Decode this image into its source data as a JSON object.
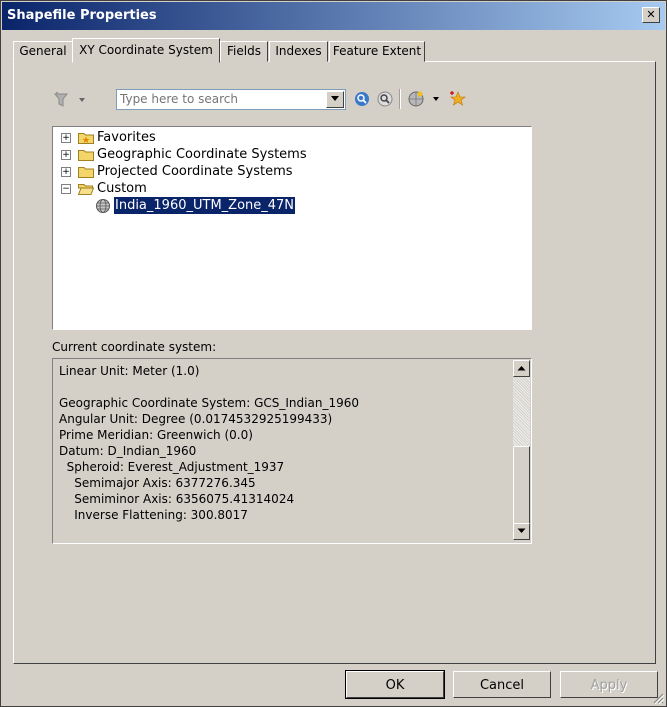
{
  "window": {
    "title": "Shapefile Properties",
    "close_glyph": "✕"
  },
  "tabs": [
    {
      "label": "General"
    },
    {
      "label": "XY Coordinate System"
    },
    {
      "label": "Fields"
    },
    {
      "label": "Indexes"
    },
    {
      "label": "Feature Extent"
    }
  ],
  "search": {
    "placeholder": "Type here to search"
  },
  "tree": {
    "items": [
      {
        "label": "Favorites",
        "expander": "+"
      },
      {
        "label": "Geographic Coordinate Systems",
        "expander": "+"
      },
      {
        "label": "Projected Coordinate Systems",
        "expander": "+"
      },
      {
        "label": "Custom",
        "expander": "−"
      },
      {
        "label": "India_1960_UTM_Zone_47N",
        "selected": true
      }
    ]
  },
  "current": {
    "label": "Current coordinate system:",
    "lines": [
      "Linear Unit: Meter (1.0)",
      "",
      "Geographic Coordinate System: GCS_Indian_1960",
      "Angular Unit: Degree (0.0174532925199433)",
      "Prime Meridian: Greenwich (0.0)",
      "Datum: D_Indian_1960",
      "  Spheroid: Everest_Adjustment_1937",
      "    Semimajor Axis: 6377276.345",
      "    Semiminor Axis: 6356075.41314024",
      "    Inverse Flattening: 300.8017"
    ]
  },
  "buttons": {
    "ok": "OK",
    "cancel": "Cancel",
    "apply": "Apply"
  },
  "colors": {
    "title_start": "#0a246a",
    "title_end": "#a6caf0",
    "selection": "#0a246a",
    "face": "#d4d0c8"
  }
}
